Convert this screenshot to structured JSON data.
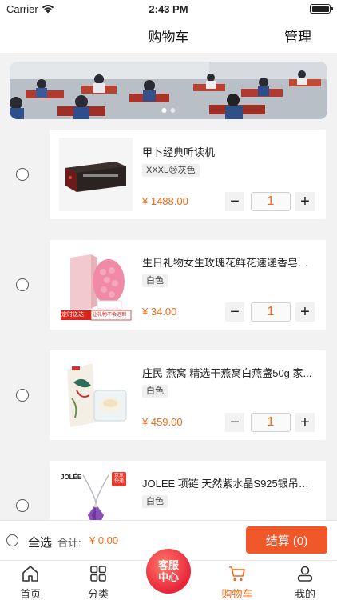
{
  "status_bar": {
    "carrier": "Carrier",
    "time": "2:43 PM"
  },
  "nav": {
    "title": "购物车",
    "manage": "管理"
  },
  "banner": {
    "dots": 2,
    "active_dot": 0
  },
  "cart_items": [
    {
      "title": "甲卜经典听读机",
      "spec": "XXXL😢灰色",
      "price": "¥ 1488.00",
      "quantity": "1",
      "minus": "−",
      "plus": "+",
      "thumb": "speaker"
    },
    {
      "title": "生日礼物女生玫瑰花鲜花速递香皂花...",
      "spec": "白色",
      "price": "¥ 34.00",
      "quantity": "1",
      "minus": "−",
      "plus": "+",
      "thumb": "flowers",
      "thumb_text_1": "定时送达",
      "thumb_text_2": "让礼物不会迟到"
    },
    {
      "title": "庄民 燕窝 精选干燕窝白燕盏50g 家...",
      "spec": "白色",
      "price": "¥ 459.00",
      "quantity": "1",
      "minus": "−",
      "plus": "+",
      "thumb": "birdnest"
    },
    {
      "title": "JOLEE 项链 天然紫水晶S925银吊坠...",
      "spec": "白色",
      "price": "",
      "quantity": "",
      "thumb": "necklace",
      "thumb_brand": "JOLÉE",
      "thumb_badge": "京东快递"
    }
  ],
  "checkout": {
    "select_all": "全选",
    "total_label": "合计:",
    "total_value": "¥ 0.00",
    "button": "结算 (0)"
  },
  "tabs": [
    {
      "label": "首页",
      "icon": "home-icon"
    },
    {
      "label": "分类",
      "icon": "grid-icon"
    },
    {
      "label": "购物车",
      "icon": "cart-icon",
      "active": true
    },
    {
      "label": "我的",
      "icon": "user-icon"
    }
  ],
  "service": {
    "line1": "客服",
    "line2": "中心"
  },
  "colors": {
    "accent": "#f06a1a",
    "checkout": "#f0582a",
    "service": "#e8253a"
  }
}
